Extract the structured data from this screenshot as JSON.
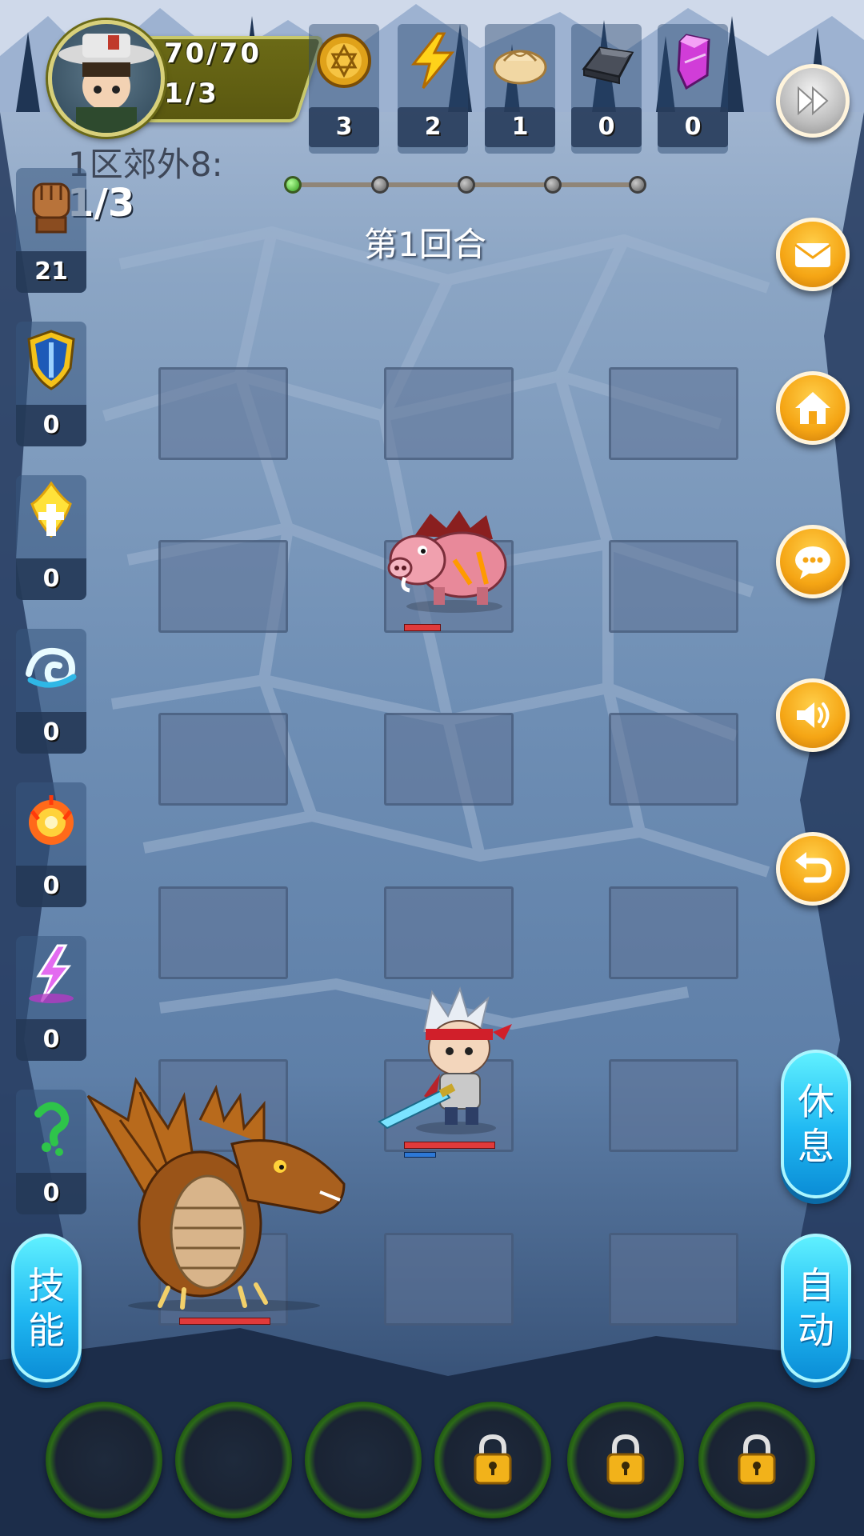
{
  "player": {
    "hp": "70/70",
    "stage_progress": "1/3"
  },
  "resources": [
    {
      "name": "gold-coin",
      "count": "3"
    },
    {
      "name": "energy-bolt",
      "count": "2"
    },
    {
      "name": "dumpling",
      "count": "1"
    },
    {
      "name": "iron-ingot",
      "count": "0"
    },
    {
      "name": "crystal-gem",
      "count": "0"
    }
  ],
  "level": {
    "title": "1区郊外8:",
    "progress": "1/3",
    "round": "第1回合"
  },
  "waves": {
    "total": 5,
    "current": 1
  },
  "elements": [
    {
      "name": "fist",
      "count": "21"
    },
    {
      "name": "shield",
      "count": "0"
    },
    {
      "name": "holy-light",
      "count": "0"
    },
    {
      "name": "water-wave",
      "count": "0"
    },
    {
      "name": "fire",
      "count": "0"
    },
    {
      "name": "lightning",
      "count": "0"
    },
    {
      "name": "poison",
      "count": "0"
    }
  ],
  "buttons": {
    "skill": [
      "技",
      "能"
    ],
    "rest": [
      "休",
      "息"
    ],
    "auto": [
      "自",
      "动"
    ]
  },
  "units": {
    "enemy_boar_hp": 1.0,
    "hero_hp": 1.0,
    "hero_mp": 0.35,
    "dragon_hp": 1.0
  },
  "skill_slots": [
    {
      "locked": false
    },
    {
      "locked": false
    },
    {
      "locked": false
    },
    {
      "locked": true
    },
    {
      "locked": true
    },
    {
      "locked": true
    }
  ],
  "colors": {
    "accent_orange": "#f5a514",
    "pill_cyan": "#1fb8f2",
    "hp_red": "#e13a3a",
    "mp_blue": "#2d78d6"
  }
}
